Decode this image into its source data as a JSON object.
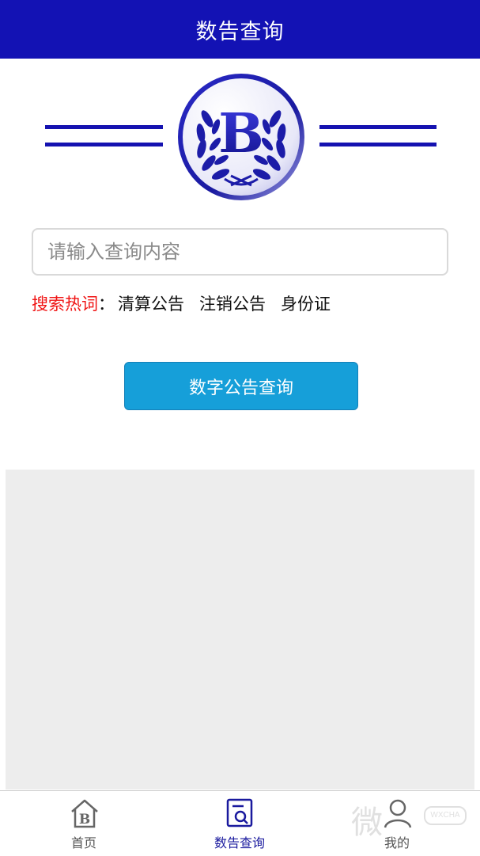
{
  "header": {
    "title": "数告查询"
  },
  "logo": {
    "letter": "B"
  },
  "search": {
    "placeholder": "请输入查询内容",
    "value": ""
  },
  "hot_search": {
    "label": "搜索热词",
    "colon": "：",
    "items": [
      "清算公告",
      "注销公告",
      "身份证"
    ]
  },
  "action": {
    "button_label": "数字公告查询"
  },
  "tabs": [
    {
      "label": "首页",
      "icon": "home-b-icon",
      "active": false
    },
    {
      "label": "数告查询",
      "icon": "search-doc-icon",
      "active": true
    },
    {
      "label": "我的",
      "icon": "user-icon",
      "active": false
    }
  ],
  "watermark": {
    "text": "微",
    "badge": "WXCHA"
  },
  "colors": {
    "header": "#1312b4",
    "accent_blue": "#1a1a9e",
    "button": "#169fd9",
    "hot_label": "#f01414",
    "panel": "#ededed"
  }
}
